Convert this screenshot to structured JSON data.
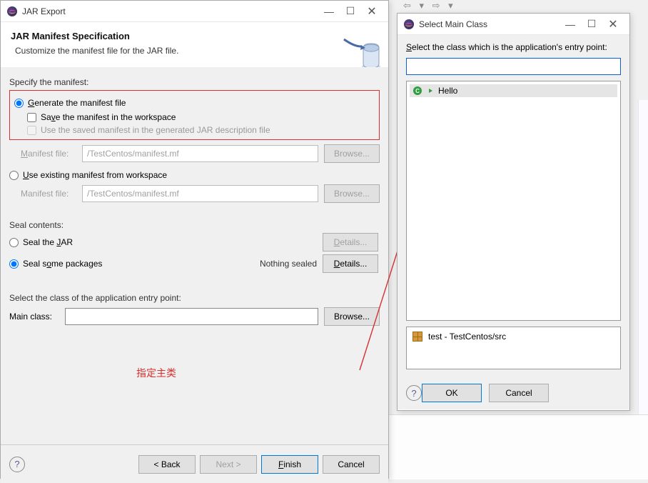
{
  "main": {
    "window_title": "JAR Export",
    "header_title": "JAR Manifest Specification",
    "header_sub": "Customize the manifest file for the JAR file.",
    "specify_label": "Specify the manifest:",
    "generate": {
      "label_pre": "G",
      "label_post": "enerate the manifest file",
      "save_pre": "Sa",
      "save_u": "v",
      "save_post": "e the manifest in the workspace",
      "reuse": "Use the saved manifest in the generated JAR description file"
    },
    "manifest_file_label_pre": "",
    "manifest_file_u": "M",
    "manifest_file_label_post": "anifest file:",
    "manifest_path": "/TestCentos/manifest.mf",
    "browse": "Browse...",
    "use_existing_pre": "",
    "use_existing_u": "U",
    "use_existing_post": "se existing manifest from workspace",
    "manifest_file2_label": "Manifest file:",
    "seal_contents": "Seal contents:",
    "seal_jar_pre": "Seal the ",
    "seal_jar_u": "J",
    "seal_jar_post": "AR",
    "seal_some_pre": "Seal s",
    "seal_some_u": "o",
    "seal_some_post": "me packages",
    "details_pre": "",
    "details_u": "D",
    "details_post": "etails...",
    "nothing_sealed": "Nothing sealed",
    "entry_prompt": "Select the class of the application entry point:",
    "main_class_label": "Main class:",
    "main_class_value": "",
    "annotation": "指定主类",
    "back": "< Back",
    "next": "Next >",
    "finish_pre": "",
    "finish_u": "F",
    "finish_post": "inish",
    "cancel": "Cancel"
  },
  "select": {
    "window_title": "Select Main Class",
    "prompt_pre": "",
    "prompt_u": "S",
    "prompt_post": "elect the class which is the application's entry point:",
    "search_value": "",
    "class_name": "Hello",
    "package_label": "test - TestCentos/src",
    "ok": "OK",
    "cancel": "Cancel"
  }
}
